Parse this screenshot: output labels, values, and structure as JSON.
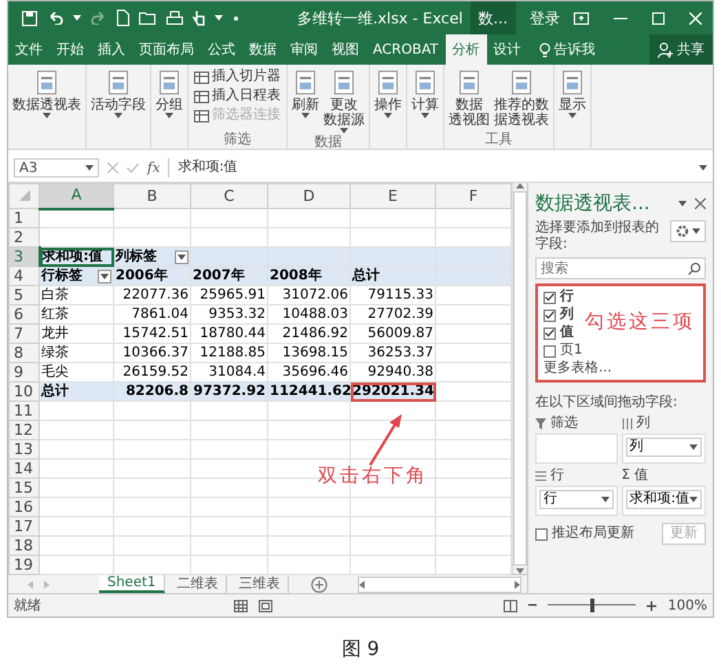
{
  "window": {
    "title": "多维转一维.xlsx - Excel",
    "context_label": "数...",
    "sign_in": "登录"
  },
  "ribbon_tabs": [
    {
      "label": "文件",
      "selected": false
    },
    {
      "label": "开始",
      "selected": false
    },
    {
      "label": "插入",
      "selected": false
    },
    {
      "label": "页面布局",
      "selected": false
    },
    {
      "label": "公式",
      "selected": false
    },
    {
      "label": "数据",
      "selected": false
    },
    {
      "label": "审阅",
      "selected": false
    },
    {
      "label": "视图",
      "selected": false
    },
    {
      "label": "ACROBAT",
      "selected": false
    },
    {
      "label": "分析",
      "selected": true
    },
    {
      "label": "设计",
      "selected": false
    }
  ],
  "tell_me": "告诉我",
  "share": "共享",
  "ribbon_groups": [
    {
      "buttons": [
        {
          "kind": "large",
          "lines": [
            "数据透视表"
          ],
          "dropdown": true,
          "disabled": false
        }
      ]
    },
    {
      "buttons": [
        {
          "kind": "large",
          "lines": [
            "活动字段"
          ],
          "dropdown": true,
          "disabled": false
        }
      ]
    },
    {
      "buttons": [
        {
          "kind": "large",
          "lines": [
            "分组"
          ],
          "dropdown": true,
          "disabled": false
        }
      ]
    },
    {
      "label": "筛选",
      "buttons": [
        {
          "kind": "small",
          "lines": [
            "插入切片器"
          ],
          "dropdown": false,
          "disabled": false
        },
        {
          "kind": "small",
          "lines": [
            "插入日程表"
          ],
          "dropdown": false,
          "disabled": false
        },
        {
          "kind": "small",
          "lines": [
            "筛选器连接"
          ],
          "dropdown": false,
          "disabled": true
        }
      ]
    },
    {
      "label": "数据",
      "buttons": [
        {
          "kind": "large",
          "lines": [
            "刷新"
          ],
          "dropdown": true,
          "disabled": false
        },
        {
          "kind": "large",
          "lines": [
            "更改",
            "数据源"
          ],
          "dropdown": true,
          "disabled": false
        }
      ]
    },
    {
      "buttons": [
        {
          "kind": "large",
          "lines": [
            "操作"
          ],
          "dropdown": true,
          "disabled": false
        }
      ]
    },
    {
      "buttons": [
        {
          "kind": "large",
          "lines": [
            "计算"
          ],
          "dropdown": true,
          "disabled": false
        }
      ]
    },
    {
      "label": "工具",
      "buttons": [
        {
          "kind": "large",
          "lines": [
            "数据",
            "透视图"
          ],
          "dropdown": false,
          "disabled": false
        },
        {
          "kind": "large",
          "lines": [
            "推荐的数",
            "据透视表"
          ],
          "dropdown": false,
          "disabled": false
        }
      ]
    },
    {
      "buttons": [
        {
          "kind": "large",
          "lines": [
            "显示"
          ],
          "dropdown": true,
          "disabled": false
        }
      ]
    }
  ],
  "formula_bar": {
    "name_box": "A3",
    "function_label": "fx",
    "formula": "求和项:值"
  },
  "sheet": {
    "columns": [
      {
        "label": "A",
        "selected": true
      },
      {
        "label": "B",
        "selected": false
      },
      {
        "label": "C",
        "selected": false
      },
      {
        "label": "D",
        "selected": false
      },
      {
        "label": "E",
        "selected": false
      },
      {
        "label": "F",
        "selected": false
      }
    ],
    "rows": [
      {
        "header": "1",
        "selected": false,
        "kind": "blank"
      },
      {
        "header": "2",
        "selected": false,
        "kind": "blank"
      },
      {
        "header": "3",
        "selected": true,
        "kind": "header",
        "cells": [
          {
            "text": "求和项:值",
            "selected": true
          },
          {
            "text": "列标签",
            "selected": false,
            "filter": true
          },
          {
            "text": "",
            "selected": false
          },
          {
            "text": "",
            "selected": false
          },
          {
            "text": "",
            "selected": false
          }
        ]
      },
      {
        "header": "4",
        "selected": false,
        "kind": "header",
        "cells": [
          {
            "text": "行标签",
            "selected": false,
            "filter": true
          },
          {
            "text": "2006年",
            "selected": false
          },
          {
            "text": "2007年",
            "selected": false
          },
          {
            "text": "2008年",
            "selected": false
          },
          {
            "text": "总计",
            "selected": false
          }
        ]
      },
      {
        "header": "5",
        "selected": false,
        "kind": "data",
        "cells": [
          {
            "text": "白茶",
            "selected": false
          },
          {
            "text": "22077.36",
            "selected": false
          },
          {
            "text": "25965.91",
            "selected": false
          },
          {
            "text": "31072.06",
            "selected": false
          },
          {
            "text": "79115.33",
            "selected": false
          }
        ]
      },
      {
        "header": "6",
        "selected": false,
        "kind": "data",
        "cells": [
          {
            "text": "红茶",
            "selected": false
          },
          {
            "text": "7861.04",
            "selected": false
          },
          {
            "text": "9353.32",
            "selected": false
          },
          {
            "text": "10488.03",
            "selected": false
          },
          {
            "text": "27702.39",
            "selected": false
          }
        ]
      },
      {
        "header": "7",
        "selected": false,
        "kind": "data",
        "cells": [
          {
            "text": "龙井",
            "selected": false
          },
          {
            "text": "15742.51",
            "selected": false
          },
          {
            "text": "18780.44",
            "selected": false
          },
          {
            "text": "21486.92",
            "selected": false
          },
          {
            "text": "56009.87",
            "selected": false
          }
        ]
      },
      {
        "header": "8",
        "selected": false,
        "kind": "data",
        "cells": [
          {
            "text": "绿茶",
            "selected": false
          },
          {
            "text": "10366.37",
            "selected": false
          },
          {
            "text": "12188.85",
            "selected": false
          },
          {
            "text": "13698.15",
            "selected": false
          },
          {
            "text": "36253.37",
            "selected": false
          }
        ]
      },
      {
        "header": "9",
        "selected": false,
        "kind": "data",
        "cells": [
          {
            "text": "毛尖",
            "selected": false
          },
          {
            "text": "26159.52",
            "selected": false
          },
          {
            "text": "31084.4",
            "selected": false
          },
          {
            "text": "35696.46",
            "selected": false
          },
          {
            "text": "92940.38",
            "selected": false
          }
        ]
      },
      {
        "header": "10",
        "selected": false,
        "kind": "total",
        "cells": [
          {
            "text": "总计",
            "selected": false
          },
          {
            "text": "82206.8",
            "selected": false
          },
          {
            "text": "97372.92",
            "selected": false
          },
          {
            "text": "112441.62",
            "selected": false
          },
          {
            "text": "292021.34",
            "selected": false,
            "marked": true
          }
        ]
      },
      {
        "header": "11",
        "selected": false,
        "kind": "blank"
      },
      {
        "header": "12",
        "selected": false,
        "kind": "blank"
      },
      {
        "header": "13",
        "selected": false,
        "kind": "blank"
      },
      {
        "header": "14",
        "selected": false,
        "kind": "blank"
      },
      {
        "header": "15",
        "selected": false,
        "kind": "blank"
      },
      {
        "header": "16",
        "selected": false,
        "kind": "blank"
      },
      {
        "header": "17",
        "selected": false,
        "kind": "blank"
      },
      {
        "header": "18",
        "selected": false,
        "kind": "blank"
      },
      {
        "header": "19",
        "selected": false,
        "kind": "blank"
      }
    ],
    "annotation": "双击右下角"
  },
  "sheet_tabs": [
    {
      "label": "Sheet1",
      "selected": true
    },
    {
      "label": "二维表",
      "selected": false
    },
    {
      "label": "三维表",
      "selected": false
    }
  ],
  "status": "就绪",
  "zoom": {
    "level": 0.5,
    "reading": "100%"
  },
  "pane": {
    "title": "数据透视表...",
    "subtitle": "选择要添加到报表的字段:",
    "search": {
      "placeholder": "搜索"
    },
    "field_list": {
      "highlighted": true,
      "items": [
        {
          "label": "行",
          "checked": true
        },
        {
          "label": "列",
          "checked": true
        },
        {
          "label": "值",
          "checked": true
        },
        {
          "label": "页1",
          "checked": false
        }
      ],
      "more": "更多表格...",
      "annotation": "勾选这三项"
    },
    "drag_label": "在以下区域间拖动字段:",
    "areas": [
      {
        "kind": "filters",
        "label": "筛选"
      },
      {
        "kind": "columns",
        "label": "列",
        "chips": [
          "列"
        ]
      },
      {
        "kind": "rows",
        "label": "行",
        "chips": [
          "行"
        ]
      },
      {
        "kind": "values",
        "symbol": "Σ",
        "label": "值",
        "chips": [
          "求和项:值"
        ]
      }
    ],
    "defer": {
      "label": "推迟布局更新",
      "checked": false
    },
    "update": {
      "label": "更新",
      "disabled": true
    }
  },
  "caption": "图 9"
}
